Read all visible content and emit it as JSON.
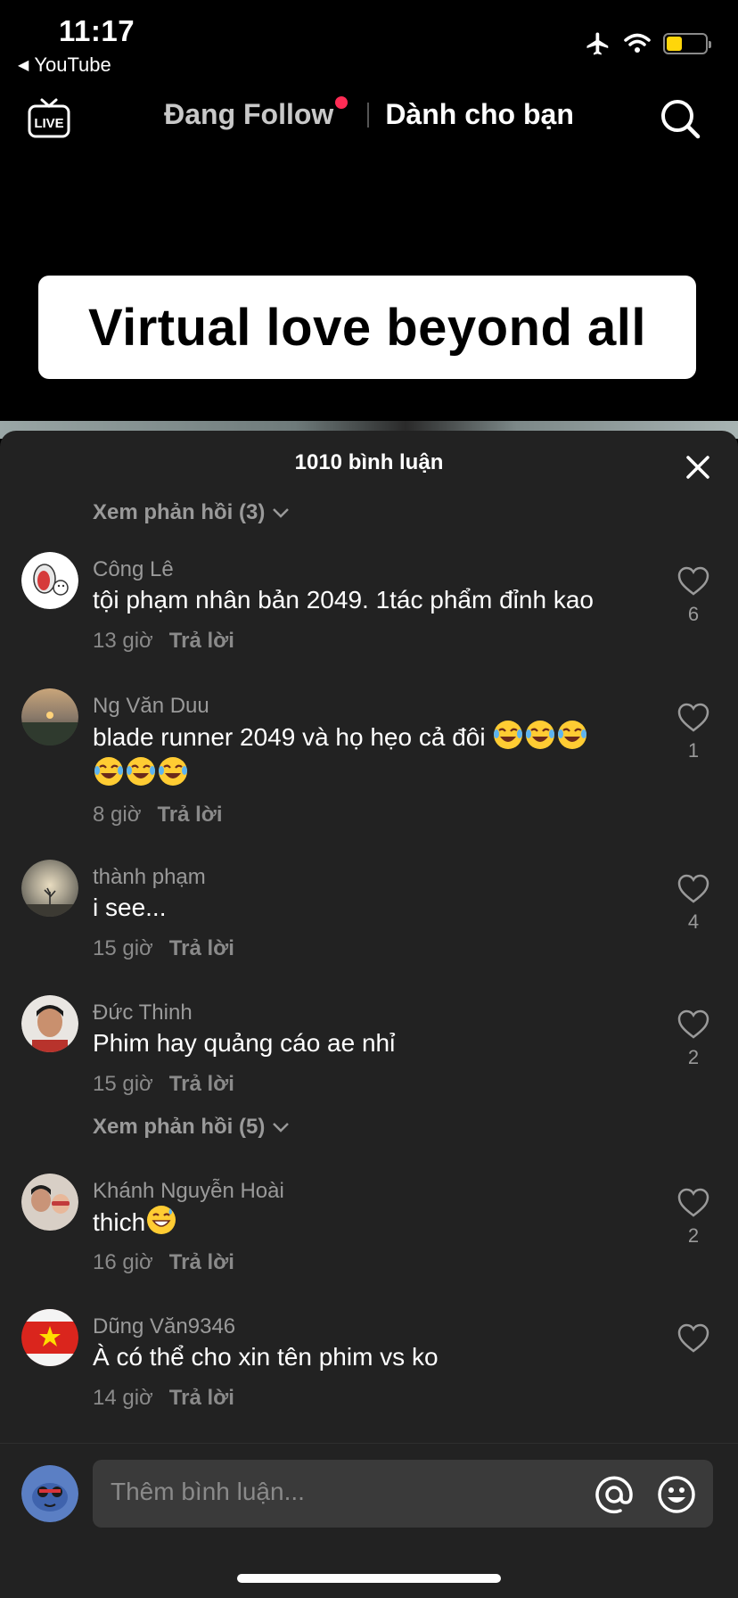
{
  "status_bar": {
    "time": "11:17",
    "back_app": "YouTube"
  },
  "nav": {
    "following": "Đang Follow",
    "for_you": "Dành cho bạn"
  },
  "caption": "Virtual love beyond all",
  "comments_sheet": {
    "title": "1010 bình luận",
    "top_view_replies": "Xem phản hồi (3)",
    "reply_label": "Trả lời",
    "comments": [
      {
        "name": "Công Lê",
        "text": "tội phạm nhân bản 2049. 1tác phẩm đỉnh kao",
        "time": "13 giờ",
        "likes": "6"
      },
      {
        "name": "Ng Văn Duu",
        "text": "blade runner 2049 và họ hẹo cả đôi",
        "time": "8 giờ",
        "likes": "1"
      },
      {
        "name": "thành phạm",
        "text": "i see...",
        "time": "15 giờ",
        "likes": "4"
      },
      {
        "name": "Đức Thinh",
        "text": "Phim hay quảng cáo ae nhỉ",
        "time": "15 giờ",
        "likes": "2",
        "view_replies": "Xem phản hồi (5)"
      },
      {
        "name": "Khánh Nguyễn Hoài",
        "text": "thich",
        "time": "16 giờ",
        "likes": "2"
      },
      {
        "name": "Dũng Văn9346",
        "text": "À có thể cho xin tên phim vs ko",
        "time": "14 giờ",
        "likes": ""
      }
    ]
  },
  "input": {
    "placeholder": "Thêm bình luận..."
  },
  "colors": {
    "accent_dot": "#fe2c55",
    "sheet_bg": "#222222",
    "battery": "#ffd60a"
  }
}
